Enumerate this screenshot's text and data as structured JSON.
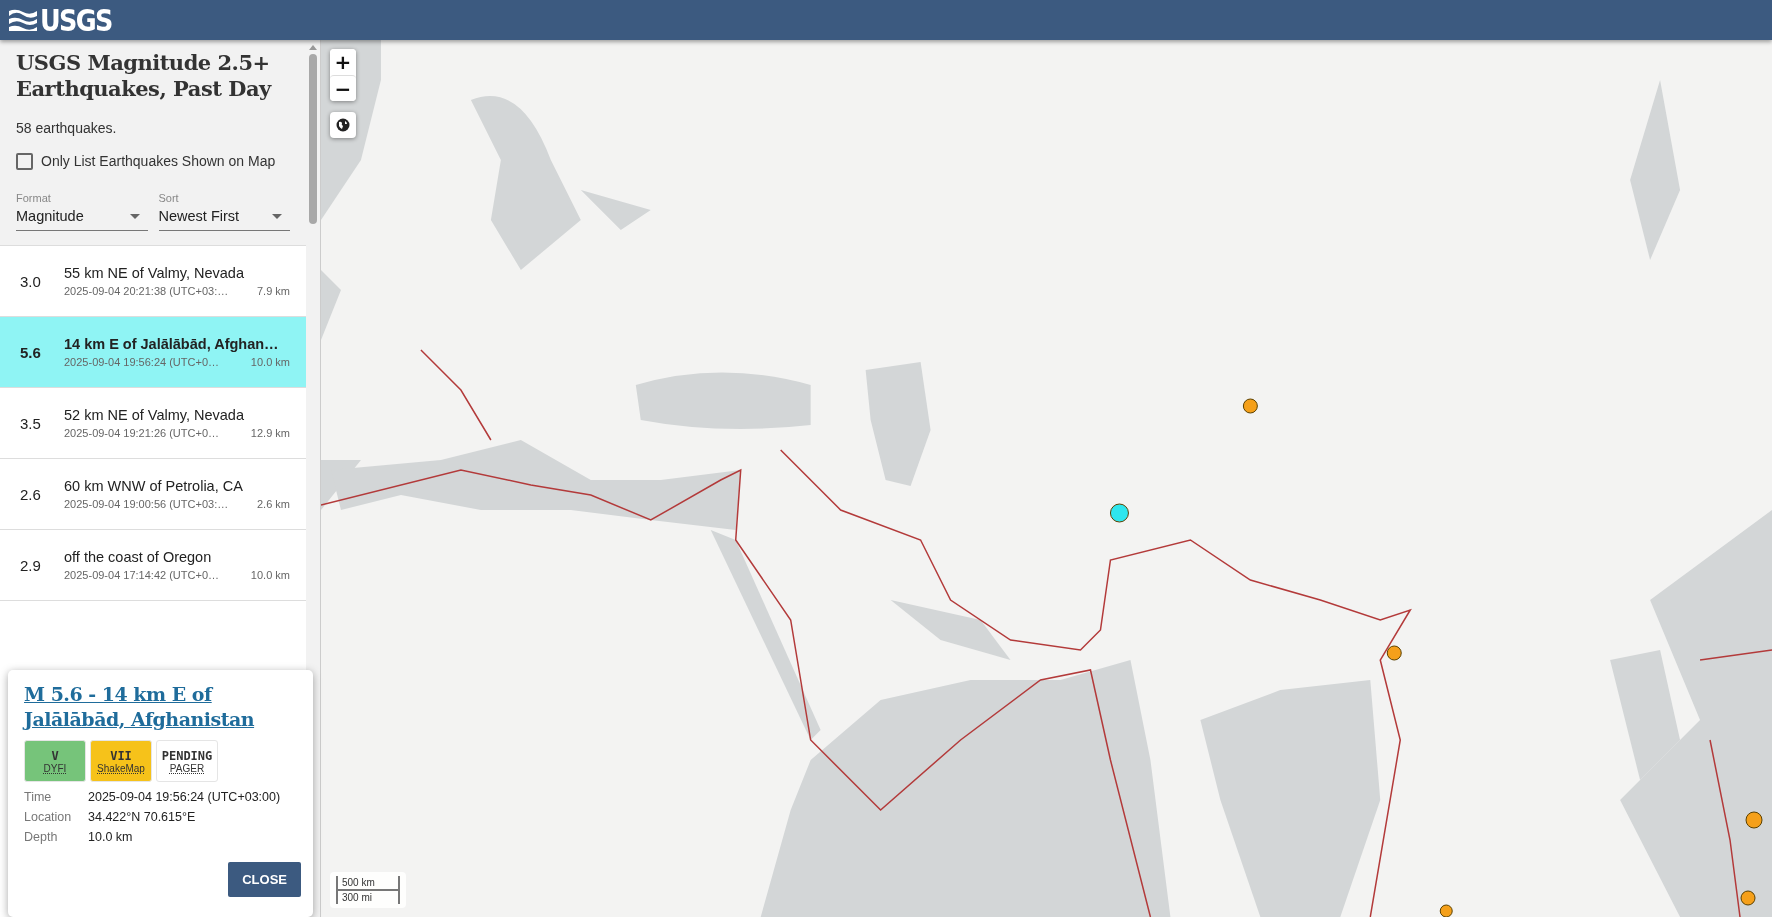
{
  "header": {
    "logo": "USGS"
  },
  "sidebar": {
    "title": "USGS Magnitude 2.5+ Earthquakes, Past Day",
    "count": "58 earthquakes.",
    "filter": {
      "label": "Only List Earthquakes Shown on Map",
      "checked": false
    },
    "format": {
      "label": "Format",
      "value": "Magnitude"
    },
    "sort": {
      "label": "Sort",
      "value": "Newest First"
    }
  },
  "earthquakes": [
    {
      "magnitude": "3.0",
      "place": "55 km NE of Valmy, Nevada",
      "time": "2025-09-04 20:21:38 (UTC+03:…",
      "depth": "7.9 km",
      "selected": false
    },
    {
      "magnitude": "5.6",
      "place": "14 km E of Jalālābād, Afghan…",
      "time": "2025-09-04 19:56:24 (UTC+0…",
      "depth": "10.0 km",
      "selected": true
    },
    {
      "magnitude": "3.5",
      "place": "52 km NE of Valmy, Nevada",
      "time": "2025-09-04 19:21:26 (UTC+0…",
      "depth": "12.9 km",
      "selected": false
    },
    {
      "magnitude": "2.6",
      "place": "60 km WNW of Petrolia, CA",
      "time": "2025-09-04 19:00:56 (UTC+03:…",
      "depth": "2.6 km",
      "selected": false
    },
    {
      "magnitude": "2.9",
      "place": "off the coast of Oregon",
      "time": "2025-09-04 17:14:42 (UTC+0…",
      "depth": "10.0 km",
      "selected": false
    }
  ],
  "map": {
    "zoom_in": "+",
    "zoom_out": "−",
    "scale": [
      "500 km",
      "300 mi"
    ]
  },
  "popup": {
    "title": "M 5.6 - 14 km E of Jalālābād, Afghanistan",
    "badges": [
      {
        "value": "V",
        "label": "DYFI",
        "color": "#76c47a"
      },
      {
        "value": "VII",
        "label": "ShakeMap",
        "color": "#f6c21a"
      },
      {
        "value": "PENDING",
        "label": "PAGER",
        "color": "#ffffff"
      }
    ],
    "details": [
      {
        "label": "Time",
        "value": "2025-09-04 19:56:24 (UTC+03:00)"
      },
      {
        "label": "Location",
        "value": "34.422°N 70.615°E"
      },
      {
        "label": "Depth",
        "value": "10.0 km"
      }
    ],
    "close": "CLOSE"
  }
}
